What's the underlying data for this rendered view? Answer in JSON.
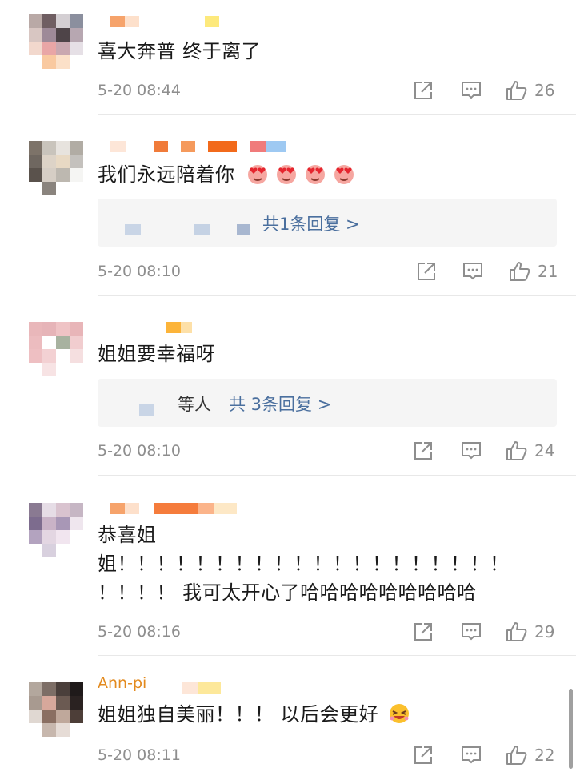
{
  "comments": [
    {
      "text": "喜大奔普 终于离了",
      "time": "5-20 08:44",
      "likes": "26"
    },
    {
      "text": "我们永远陪着你",
      "emoji": "heart-eyes-emoji",
      "reply_summary": "共1条回复 >",
      "time": "5-20 08:10",
      "likes": "21"
    },
    {
      "text": "姐姐要幸福呀",
      "reply_prefix": "等人",
      "reply_summary": "共 3条回复 >",
      "time": "5-20 08:10",
      "likes": "24"
    },
    {
      "text_line1": "恭喜姐",
      "text_line2": "姐！！！！！！！！！！！！！！！！！！！！",
      "text_line3": "！！！！ 我可太开心了哈哈哈哈哈哈哈哈哈",
      "time": "5-20 08:16",
      "likes": "29"
    },
    {
      "username": "Ann-pi",
      "text": "姐姐独自美丽！！！ 以后会更好",
      "emoji": "laughing-emoji",
      "time": "5-20 08:11",
      "likes": "22"
    }
  ],
  "icons": {
    "share": "share-icon",
    "comment": "comment-icon",
    "like": "thumbs-up-icon"
  },
  "colors": {
    "link": "#4a6f9e",
    "username": "#e38a1e",
    "meta": "#8e8e8e"
  }
}
